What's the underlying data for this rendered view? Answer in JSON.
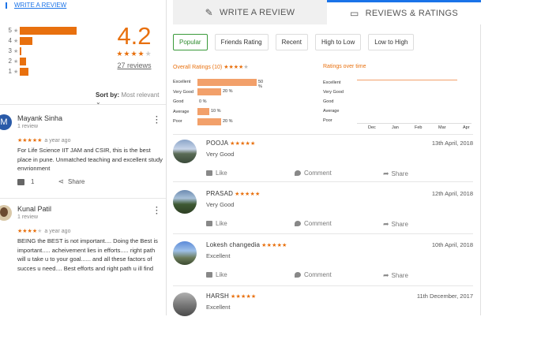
{
  "left": {
    "write_review": "WRITE A REVIEW",
    "histogram": [
      {
        "label": "5",
        "fill": 1.0
      },
      {
        "label": "4",
        "fill": 0.2
      },
      {
        "label": "3",
        "fill": 0.02
      },
      {
        "label": "2",
        "fill": 0.1
      },
      {
        "label": "1",
        "fill": 0.14
      }
    ],
    "average": "4.2",
    "review_count": "27 reviews",
    "sort_label": "Sort by:",
    "sort_value": "Most relevant",
    "reviews": [
      {
        "initial": "M",
        "name": "Mayank Sinha",
        "sub": "1 review",
        "ago": "a year ago",
        "text": "For Life Science IIT JAM and CSIR, this is the best place in pune. Unmatched teaching and excellent study envrionment",
        "likes": "1",
        "share": "Share"
      },
      {
        "name": "Kunal Patil",
        "sub": "1 review",
        "ago": "a year ago",
        "text": "BEING the BEST is not important.... Doing the Best is important..... acheivement lies in efforts..... right path will u take u to your goal...... and all these factors of succes u need.... Best efforts and right path u ill find"
      }
    ]
  },
  "right": {
    "tab_write": "WRITE A REVIEW",
    "tab_ratings": "REVIEWS & RATINGS",
    "filters": [
      "Popular",
      "Friends Rating",
      "Recent",
      "High to Low",
      "Low to High"
    ],
    "overall_title": "Overall Ratings (10)",
    "overall_bars": [
      {
        "label": "Excellent",
        "pct": "50 %",
        "value": 50
      },
      {
        "label": "Very Good",
        "pct": "20 %",
        "value": 20
      },
      {
        "label": "Good",
        "pct": "0 %",
        "value": 0
      },
      {
        "label": "Average",
        "pct": "10 %",
        "value": 10
      },
      {
        "label": "Poor",
        "pct": "20 %",
        "value": 20
      }
    ],
    "time_title": "Ratings over time",
    "time_ylabels": [
      "Excellent",
      "Very Good",
      "Good",
      "Average",
      "Poor"
    ],
    "time_xlabels": [
      "Dec",
      "Jan",
      "Feb",
      "Mar",
      "Apr"
    ],
    "like": "Like",
    "comment": "Comment",
    "share": "Share",
    "reviews": [
      {
        "name": "POOJA",
        "date": "13th April, 2018",
        "label": "Very Good",
        "stars": "★★★★★"
      },
      {
        "name": "PRASAD",
        "date": "12th April, 2018",
        "label": "Very Good",
        "stars": "★★★★★"
      },
      {
        "name": "Lokesh changedia",
        "date": "10th April, 2018",
        "label": "Excellent",
        "stars": "★★★★★"
      },
      {
        "name": "HARSH",
        "date": "11th December, 2017",
        "label": "Excellent",
        "stars": "★★★★★"
      }
    ]
  }
}
